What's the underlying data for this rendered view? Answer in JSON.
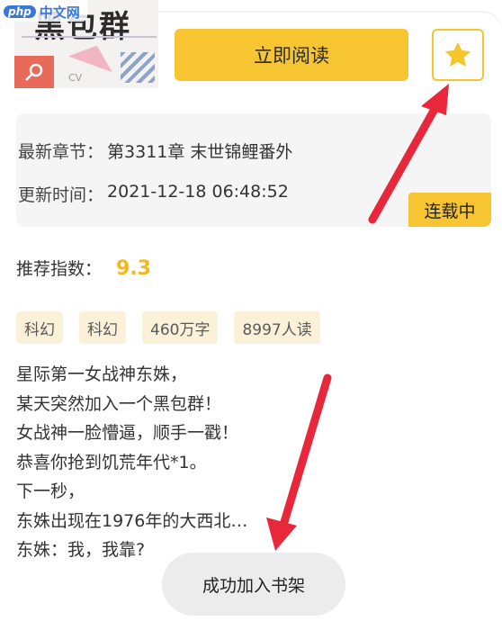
{
  "watermark": {
    "logo": "php",
    "text": "中文网"
  },
  "book": {
    "cover_title": "黑包群",
    "cover_sub": "CV"
  },
  "actions": {
    "read_label": "立即阅读",
    "favorite_icon": "star-icon"
  },
  "info": {
    "latest_label": "最新章节：",
    "latest_value": "第3311章 末世锦鲤番外",
    "updated_label": "更新时间：",
    "updated_value": "2021-12-18 06:48:52",
    "status": "连载中"
  },
  "rating": {
    "label": "推荐指数：",
    "value": "9.3"
  },
  "tags": [
    "科幻",
    "科幻",
    "460万字",
    "8997人读"
  ],
  "description": [
    "星际第一女战神东姝，",
    "某天突然加入一个黑包群！",
    "女战神一脸懵逼，顺手一戳！",
    "恭喜你抢到饥荒年代*1。",
    "下一秒，",
    "东姝出现在1976年的大西北…",
    "东姝：我，我靠?"
  ],
  "toast": {
    "message": "成功加入书架"
  },
  "colors": {
    "accent": "#f7c531",
    "arrow": "#e8283a",
    "tag_bg": "#fbf0d8"
  }
}
